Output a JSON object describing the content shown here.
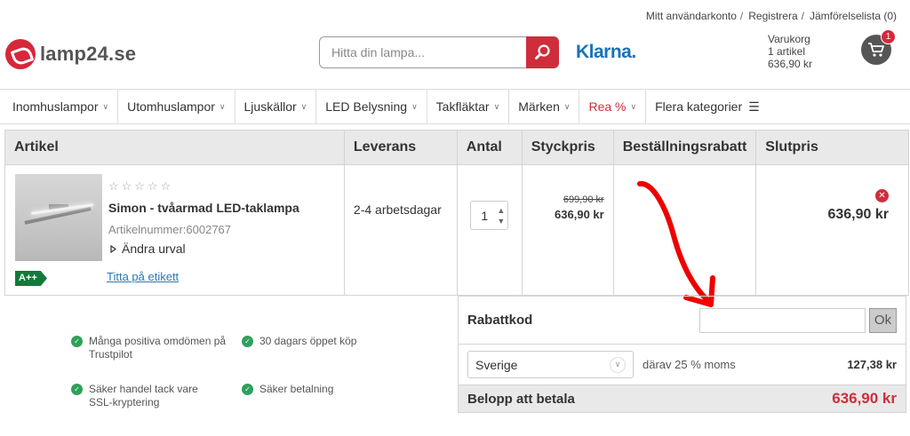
{
  "header": {
    "links": [
      "Mitt användarkonto",
      "Registrera",
      "Jämförelselista (0)"
    ],
    "logo_text": "lamp24.se",
    "search_placeholder": "Hitta din lampa...",
    "klarna": "Klarna.",
    "cart": {
      "title": "Varukorg",
      "items": "1 artikel",
      "amount": "636,90 kr",
      "badge": "1"
    }
  },
  "nav": [
    {
      "label": "Inomhuslampor"
    },
    {
      "label": "Utomhuslampor"
    },
    {
      "label": "Ljuskällor"
    },
    {
      "label": "LED Belysning"
    },
    {
      "label": "Takfläktar"
    },
    {
      "label": "Märken"
    },
    {
      "label": "Rea %"
    },
    {
      "label": "Flera kategorier"
    }
  ],
  "table": {
    "headers": [
      "Artikel",
      "Leverans",
      "Antal",
      "Styckpris",
      "Beställningsrabatt",
      "Slutpris"
    ],
    "product": {
      "stars": "☆☆☆☆☆",
      "name": "Simon - tvåarmad LED-taklampa",
      "article_number": "Artikelnummer:6002767",
      "change": "Ändra urval",
      "energy": "A++",
      "label_link": "Titta på etikett",
      "delivery": "2-4 arbetsdagar",
      "quantity": "1",
      "old_price": "699,90 kr",
      "price": "636,90 kr",
      "total": "636,90 kr"
    }
  },
  "summary": {
    "coupon_label": "Rabattkod",
    "coupon_value": "",
    "ok": "Ok",
    "country": "Sverige",
    "vat_label": "därav 25 % moms",
    "vat_value": "127,38 kr",
    "pay_label": "Belopp att betala",
    "pay_amount": "636,90 kr"
  },
  "trust": [
    {
      "text": "Många positiva omdömen på Trustpilot"
    },
    {
      "text": "30 dagars öppet köp"
    },
    {
      "text": "Säker handel tack vare SSL-kryptering"
    },
    {
      "text": "Säker betalning"
    }
  ],
  "colors": {
    "brand_red": "#cf2d3c",
    "klarna_blue": "#1a72b8",
    "energy_green": "#117a3a",
    "check_green": "#2fa05a"
  }
}
